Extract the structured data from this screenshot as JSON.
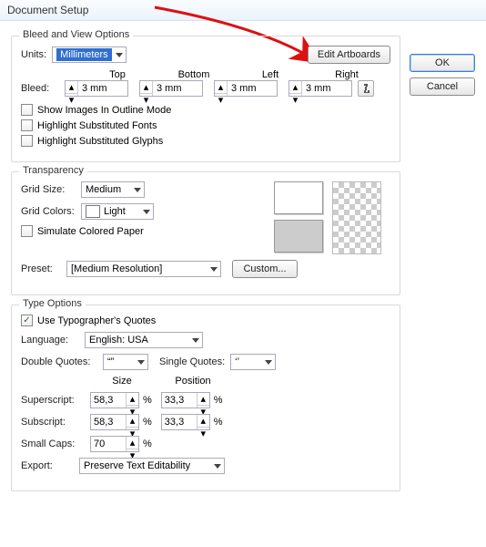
{
  "title": "Document Setup",
  "buttons": {
    "ok": "OK",
    "cancel": "Cancel",
    "editArtboards": "Edit Artboards",
    "custom": "Custom..."
  },
  "bleed": {
    "legend": "Bleed and View Options",
    "unitsLabel": "Units:",
    "unitsValue": "Millimeters",
    "headers": {
      "top": "Top",
      "bottom": "Bottom",
      "left": "Left",
      "right": "Right"
    },
    "bleedLabel": "Bleed:",
    "values": {
      "top": "3 mm",
      "bottom": "3 mm",
      "left": "3 mm",
      "right": "3 mm"
    },
    "checks": {
      "outline": "Show Images In Outline Mode",
      "fonts": "Highlight Substituted Fonts",
      "glyphs": "Highlight Substituted Glyphs"
    }
  },
  "transparency": {
    "legend": "Transparency",
    "gridSizeLabel": "Grid Size:",
    "gridSizeValue": "Medium",
    "gridColorsLabel": "Grid Colors:",
    "gridColorsValue": "Light",
    "simulate": "Simulate Colored Paper",
    "presetLabel": "Preset:",
    "presetValue": "[Medium Resolution]",
    "swatchTop": "#ffffff",
    "swatchBottom": "#cccccc"
  },
  "type": {
    "legend": "Type Options",
    "typographers": "Use Typographer's Quotes",
    "typographersChecked": true,
    "languageLabel": "Language:",
    "languageValue": "English: USA",
    "dqLabel": "Double Quotes:",
    "dqValue": "“”",
    "sqLabel": "Single Quotes:",
    "sqValue": "‘’",
    "sizeHdr": "Size",
    "posHdr": "Position",
    "superLabel": "Superscript:",
    "superSize": "58,3",
    "superPos": "33,3",
    "subLabel": "Subscript:",
    "subSize": "58,3",
    "subPos": "33,3",
    "smallCapsLabel": "Small Caps:",
    "smallCapsVal": "70",
    "exportLabel": "Export:",
    "exportValue": "Preserve Text Editability",
    "pct": "%"
  }
}
